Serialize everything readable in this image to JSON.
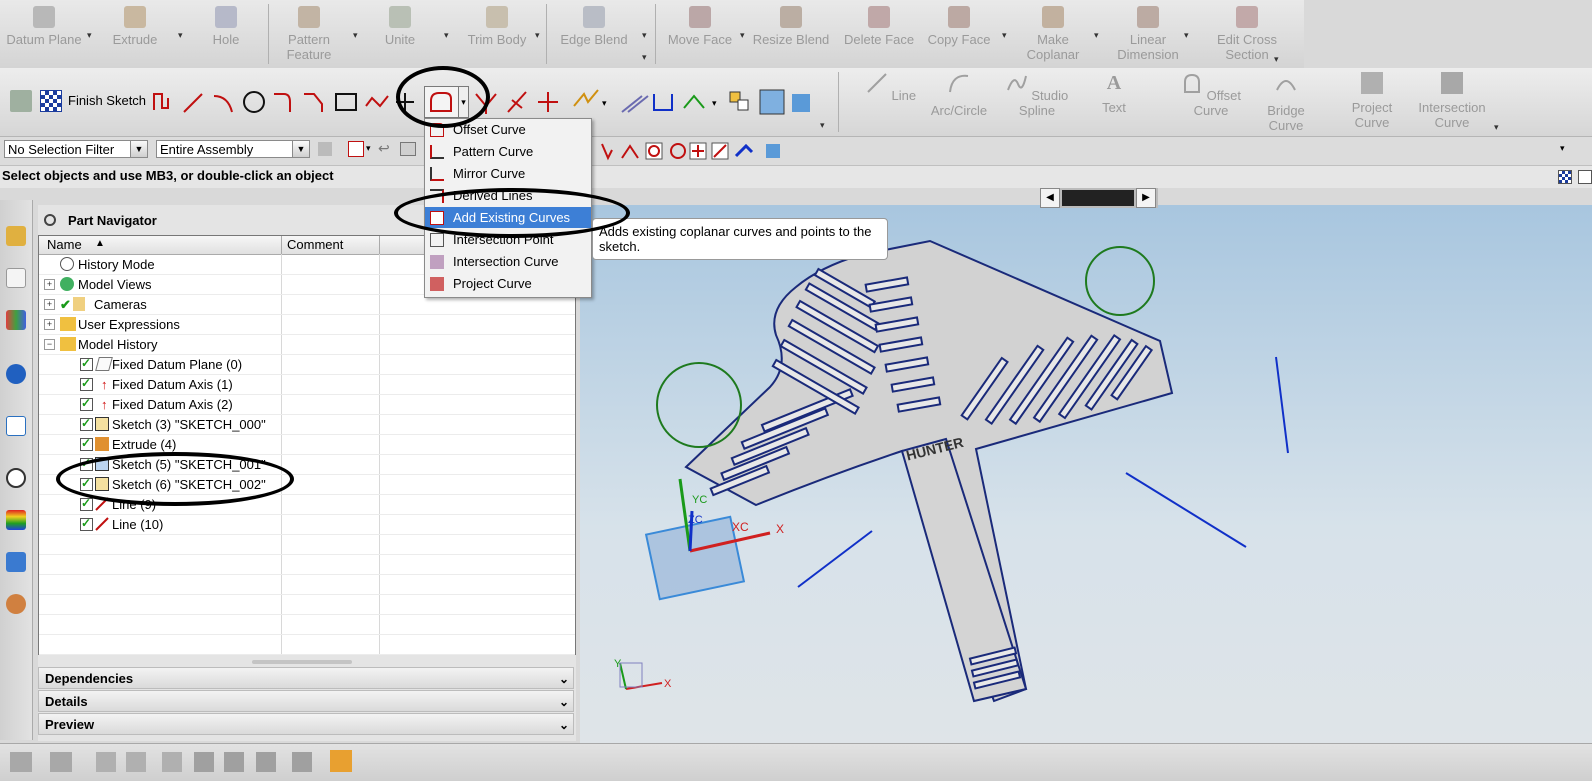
{
  "ribbon_row1": {
    "items": [
      {
        "label": "Datum Plane"
      },
      {
        "label": "Extrude"
      },
      {
        "label": "Hole"
      },
      {
        "label": "Pattern Feature"
      },
      {
        "label": "Unite"
      },
      {
        "label": "Trim Body"
      },
      {
        "label": "Edge Blend"
      },
      {
        "label": "Move Face"
      },
      {
        "label": "Resize Blend"
      },
      {
        "label": "Delete Face"
      },
      {
        "label": "Copy Face"
      },
      {
        "label": "Make Coplanar"
      },
      {
        "label": "Linear Dimension"
      },
      {
        "label": "Edit Cross Section"
      }
    ]
  },
  "ribbon_row2": {
    "finish_sketch": "Finish Sketch",
    "right_items": [
      {
        "label": "Line"
      },
      {
        "label": "Arc/Circle"
      },
      {
        "label": "Studio Spline"
      },
      {
        "label": "Text"
      },
      {
        "label": "Offset Curve"
      },
      {
        "label": "Bridge Curve"
      },
      {
        "label": "Project Curve"
      },
      {
        "label": "Intersection Curve"
      }
    ]
  },
  "selection_bar": {
    "filter": "No Selection Filter",
    "scope": "Entire Assembly"
  },
  "status_text": "Select objects and use MB3, or double-click an object",
  "curve_menu": {
    "items": [
      {
        "label": "Offset Curve"
      },
      {
        "label": "Pattern Curve"
      },
      {
        "label": "Mirror Curve"
      },
      {
        "label": "Derived Lines"
      },
      {
        "label": "Add Existing Curves"
      },
      {
        "label": "Intersection Point"
      },
      {
        "label": "Intersection Curve"
      },
      {
        "label": "Project Curve"
      }
    ],
    "selected_index": 4
  },
  "tooltip": "Adds existing coplanar curves and points to the sketch.",
  "navigator": {
    "title": "Part Navigator",
    "columns": {
      "name": "Name",
      "comment": "Comment"
    },
    "rows": [
      {
        "label": "History Mode"
      },
      {
        "label": "Model Views"
      },
      {
        "label": "Cameras"
      },
      {
        "label": "User Expressions"
      },
      {
        "label": "Model History"
      },
      {
        "label": "Fixed Datum Plane (0)"
      },
      {
        "label": "Fixed Datum Axis (1)"
      },
      {
        "label": "Fixed Datum Axis (2)"
      },
      {
        "label": "Sketch (3) \"SKETCH_000\""
      },
      {
        "label": "Extrude (4)"
      },
      {
        "label": "Sketch (5) \"SKETCH_001\""
      },
      {
        "label": "Sketch (6) \"SKETCH_002\""
      },
      {
        "label": "Line (9)"
      },
      {
        "label": "Line (10)"
      }
    ],
    "panels": {
      "dependencies": "Dependencies",
      "details": "Details",
      "preview": "Preview"
    }
  },
  "viewport": {
    "part_text": "HUNTER",
    "axis_labels": {
      "xc": "XC",
      "x": "X",
      "yc": "YC",
      "zc": "ZC",
      "y": "Y"
    }
  },
  "colors": {
    "highlight": "#3d7fd6",
    "part_fill": "#d4d4d4",
    "part_edge": "#1a2a7a",
    "circle": "#1e7a1e",
    "line": "#1030c8",
    "annotation": "#000000"
  }
}
